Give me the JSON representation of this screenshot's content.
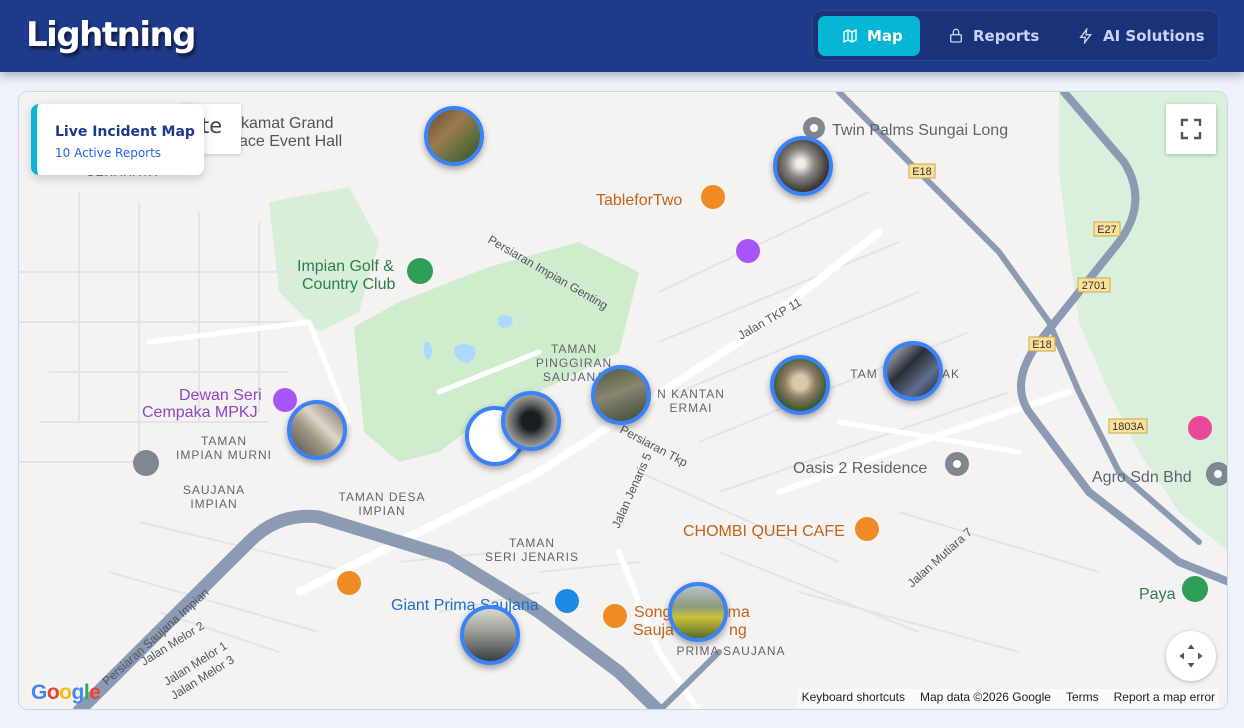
{
  "app": {
    "title": "Lightning"
  },
  "nav": {
    "tabs": [
      {
        "label": "Map"
      },
      {
        "label": "Reports"
      },
      {
        "label": "AI Solutions"
      }
    ]
  },
  "overlay": {
    "title": "Live Incident Map",
    "subtitle": "10 Active Reports"
  },
  "stub_text": "te",
  "footer": {
    "shortcuts": "Keyboard shortcuts",
    "mapdata": "Map data ©2026 Google",
    "terms": "Terms",
    "report": "Report a map error"
  },
  "google_logo": "Google",
  "colors": {
    "header": "#1e3a8a",
    "accent": "#06b6d4",
    "marker_border": "#3b82f6"
  },
  "places": {
    "kamat": "kamat Grand",
    "ace": "ace Event Hall",
    "twin": "Twin Palms Sungai Long",
    "table": "TableforTwo",
    "golf1": "Impian Golf &",
    "golf2": "Country Club",
    "dewan1": "Dewan Seri",
    "dewan2": "Cempaka MPKJ",
    "oasis": "Oasis 2 Residence",
    "agro": "Agro Sdn Bhd",
    "chombi": "CHOMBI QUEH CAFE",
    "giant": "Giant Prima Saujana",
    "song1": "Song",
    "song2": "ima",
    "song3": "Sauja",
    "song4": "ng",
    "paya": "Paya"
  },
  "areas": {
    "pinggiran": [
      "TAMAN",
      "PINGGIRAN",
      "SAUJANA"
    ],
    "kantan": [
      "N KANTAN",
      "ERMAI"
    ],
    "impianmurni": [
      "TAMAN",
      "IMPIAN MURNI"
    ],
    "saujanaimpian": [
      "SAUJANA",
      "IMPIAN"
    ],
    "desa": [
      "TAMAN DESA",
      "IMPIAN"
    ],
    "senjenaris": [
      "TAMAN",
      "SERI JENARIS"
    ],
    "primasaujana": "PRIMA SAUJANA",
    "tamk": [
      "TAM",
      "AK"
    ],
    "cerahaya": "CERAHAYA"
  },
  "roads": {
    "genting": "Persiaran Impian Genting",
    "tkp11": "Jalan TKP 11",
    "tkp": "Persiaran Tkp",
    "jenaris5": "Jalan Jenaris 5",
    "mutiara": "Jalan Mutiara 7",
    "saujanaimpian": "Persiaran Saujana Impian",
    "melor1": "Jalan Melor 1",
    "melor2": "Jalan Melor 2",
    "melor3": "Jalan Melor 3"
  },
  "shields": {
    "e18a": "E18",
    "e27": "E27",
    "r2701": "2701",
    "e18b": "E18",
    "r1803": "1803A"
  },
  "markers": [
    {
      "id": "m1",
      "photo": "garden-path"
    },
    {
      "id": "m2",
      "photo": "raccoon"
    },
    {
      "id": "m3",
      "photo": "road-barrier"
    },
    {
      "id": "m4",
      "photo": "document"
    },
    {
      "id": "m5",
      "photo": "sinkhole"
    },
    {
      "id": "m6",
      "photo": "fallen-branches"
    },
    {
      "id": "m7",
      "photo": "monkey"
    },
    {
      "id": "m8",
      "photo": "dark-water"
    },
    {
      "id": "m9",
      "photo": "floor-tiles"
    },
    {
      "id": "m10",
      "photo": "flood-field"
    }
  ]
}
